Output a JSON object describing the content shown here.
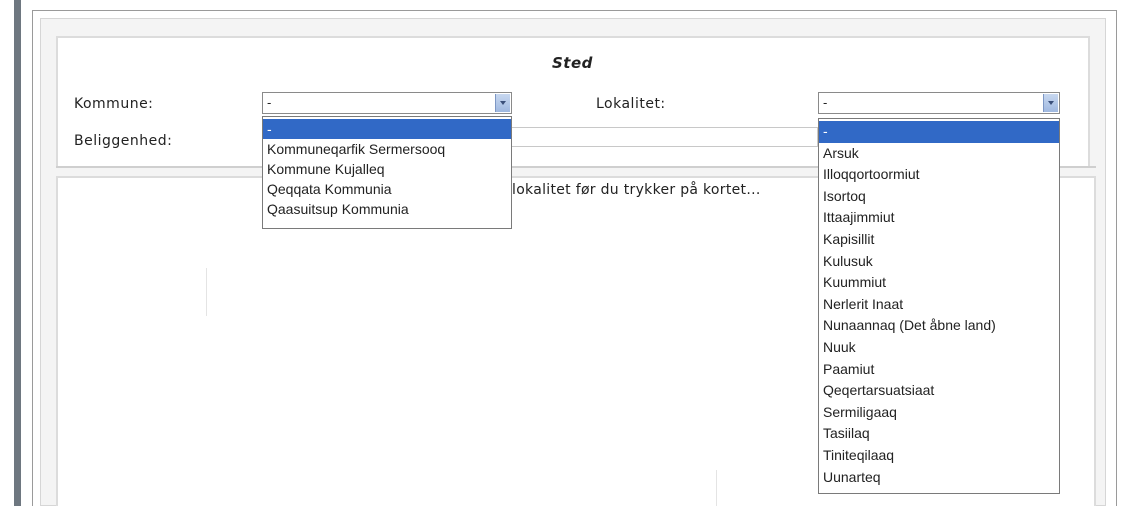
{
  "form": {
    "title": "Sted",
    "kommune_label": "Kommune:",
    "lokalitet_label": "Lokalitet:",
    "beliggenhed_label": "Beliggenhed:",
    "kommune_value": "-",
    "lokalitet_value": "-"
  },
  "kommune_options": [
    "-",
    "Kommuneqarfik Sermersooq",
    "Kommune Kujalleq",
    "Qeqqata Kommunia",
    "Qaasuitsup Kommunia"
  ],
  "lokalitet_options": [
    "-",
    "Arsuk",
    "Illoqqortoormiut",
    "Isortoq",
    "Ittaajimmiut",
    "Kapisillit",
    "Kulusuk",
    "Kuummiut",
    "Nerlerit Inaat",
    "Nunaannaq (Det åbne land)",
    "Nuuk",
    "Paamiut",
    "Qeqertarsuatsiaat",
    "Sermiligaaq",
    "Tasiilaq",
    "Tiniteqilaaq",
    "Uunarteq"
  ],
  "map": {
    "hint": "lokalitet før du trykker på kortet..."
  },
  "colors": {
    "selected_option": "#3169c6",
    "frame": "#6e7780"
  }
}
